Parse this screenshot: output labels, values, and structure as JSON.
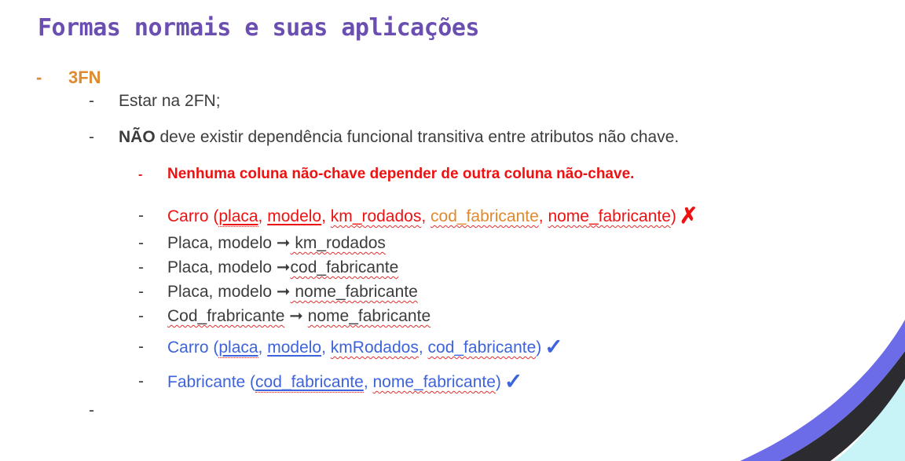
{
  "title": "Formas normais e suas aplicações",
  "section": {
    "bullet": "-",
    "label": "3FN"
  },
  "bullet_char": "-",
  "items": {
    "estar": "Estar na 2FN;",
    "nao_bold": "NÃO",
    "nao_rest": " deve existir dependência funcional transitiva entre atributos não chave.",
    "rule": "Nenhuma coluna não-chave depender de outra coluna não-chave."
  },
  "carro_bad": {
    "name": "Carro (",
    "placa": "placa",
    "sep1": ", ",
    "modelo": "modelo",
    "sep2": ", ",
    "km": "km_rodados",
    "sep3": ", ",
    "cod": "cod_fabricante",
    "sep4": ", ",
    "nome": "nome_fabricante",
    "close": ")",
    "mark": "✗"
  },
  "deps": [
    {
      "left": "Placa, modelo ",
      "arrow": "➞",
      "right": " km_rodados"
    },
    {
      "left": "Placa, modelo ",
      "arrow": "➞",
      "right": "cod_fabricante"
    },
    {
      "left": "Placa, modelo ",
      "arrow": "➞",
      "right": " nome_fabricante"
    },
    {
      "left": "Cod_frabricante",
      "arrow": " ➞ ",
      "right": "nome_fabricante"
    }
  ],
  "carro_good": {
    "name": "Carro (",
    "placa": "placa",
    "sep1": ", ",
    "modelo": "modelo",
    "sep2": ", ",
    "km": "kmRodados",
    "sep3": ", ",
    "cod": "cod_fabricante",
    "close": ")",
    "mark": "✓"
  },
  "fabricante": {
    "name": "Fabricante (",
    "cod": "cod_fabricante",
    "sep": ", ",
    "nome": "nome_fabricante",
    "close": ")",
    "mark": "✓"
  },
  "colors": {
    "title": "#6a4fb0",
    "heading": "#e08a30",
    "red": "#ee1111",
    "blue": "#3d63dd",
    "deco_dark": "#2b2b30",
    "deco_purple": "#6c6ce8",
    "deco_cyan": "#c8f4f8"
  }
}
